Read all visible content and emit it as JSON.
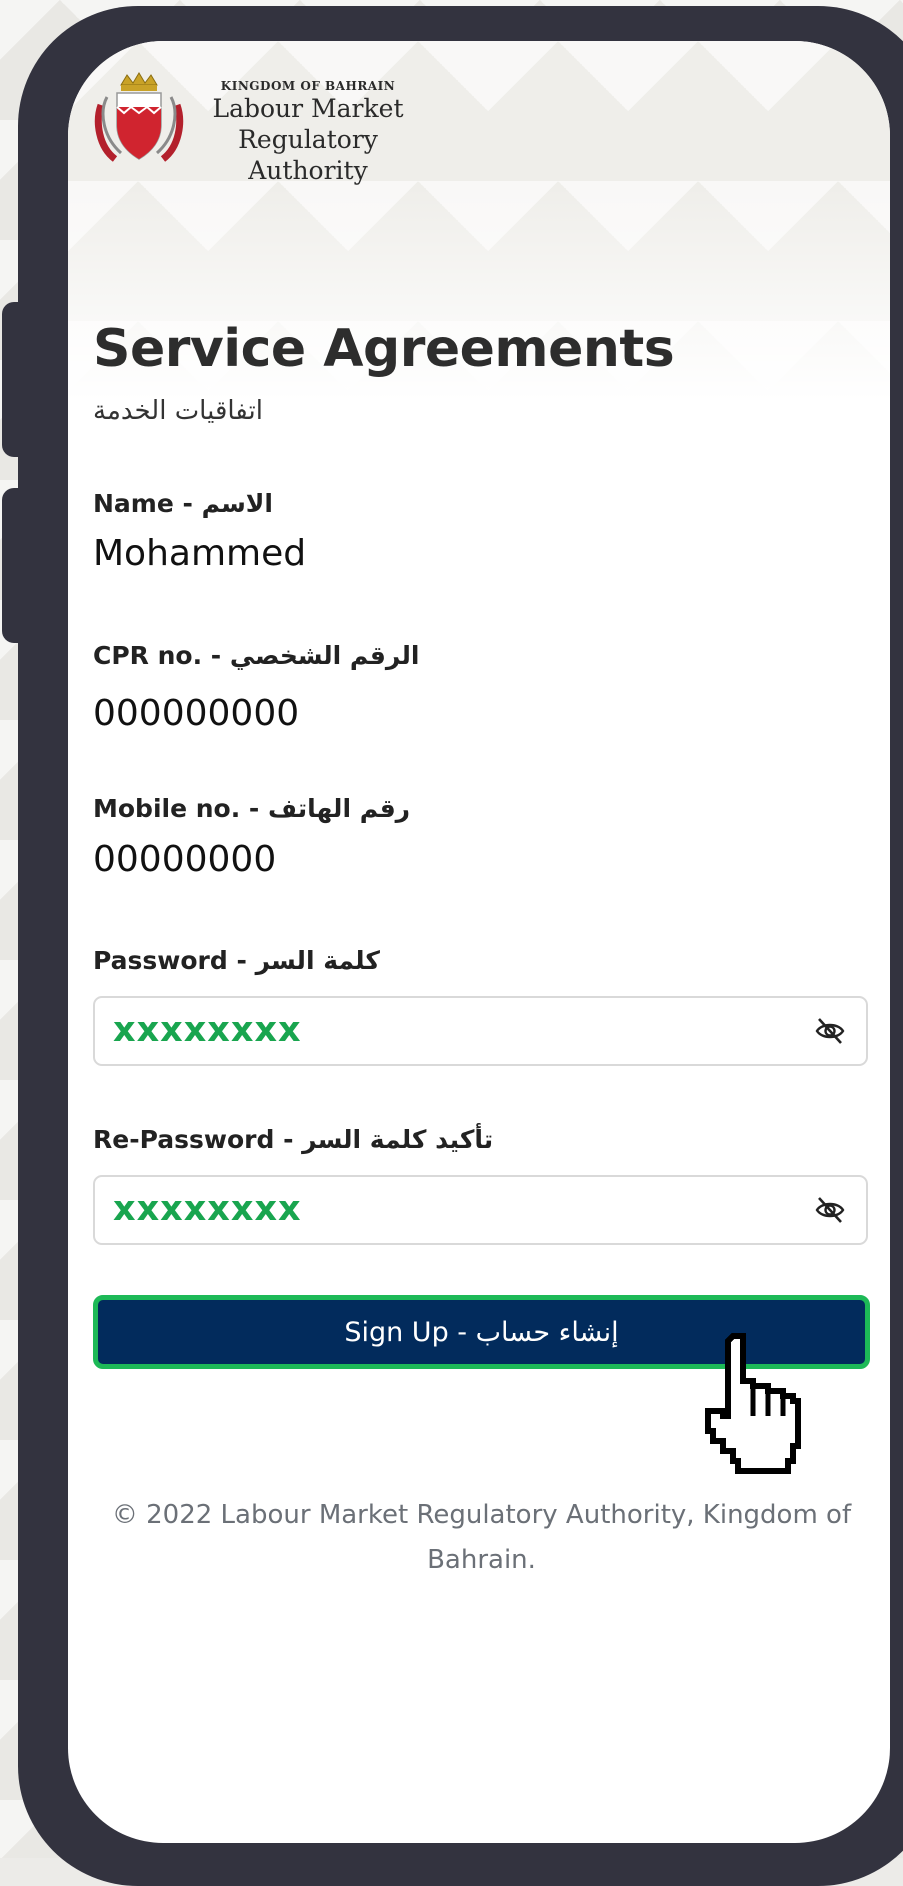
{
  "header": {
    "org_small": "KINGDOM OF BAHRAIN",
    "org_line1": "Labour Market",
    "org_line2": "Regulatory Authority",
    "logo_icon": "bahrain-coat-of-arms"
  },
  "page": {
    "title": "Service Agreements",
    "subtitle": "اتفاقيات الخدمة"
  },
  "fields": {
    "name_label": "Name - الاسم",
    "name_value": "Mohammed",
    "cpr_label": "CPR no. - الرقم الشخصي",
    "cpr_value": "000000000",
    "mobile_label": "Mobile no. - رقم الهاتف",
    "mobile_value": "00000000",
    "password_label": "Password - كلمة السر",
    "password_value": "xxxxxxxx",
    "repassword_label": "Re-Password - تأكيد كلمة السر",
    "repassword_value": "xxxxxxxx"
  },
  "actions": {
    "signup_label": "Sign Up - إنشاء حساب"
  },
  "footer": {
    "copyright": "© 2022 Labour Market Regulatory Authority, Kingdom of Bahrain."
  },
  "colors": {
    "primary": "#022b5c",
    "accent_green": "#1db957",
    "password_text": "#19a54f",
    "frame": "#33333f"
  }
}
